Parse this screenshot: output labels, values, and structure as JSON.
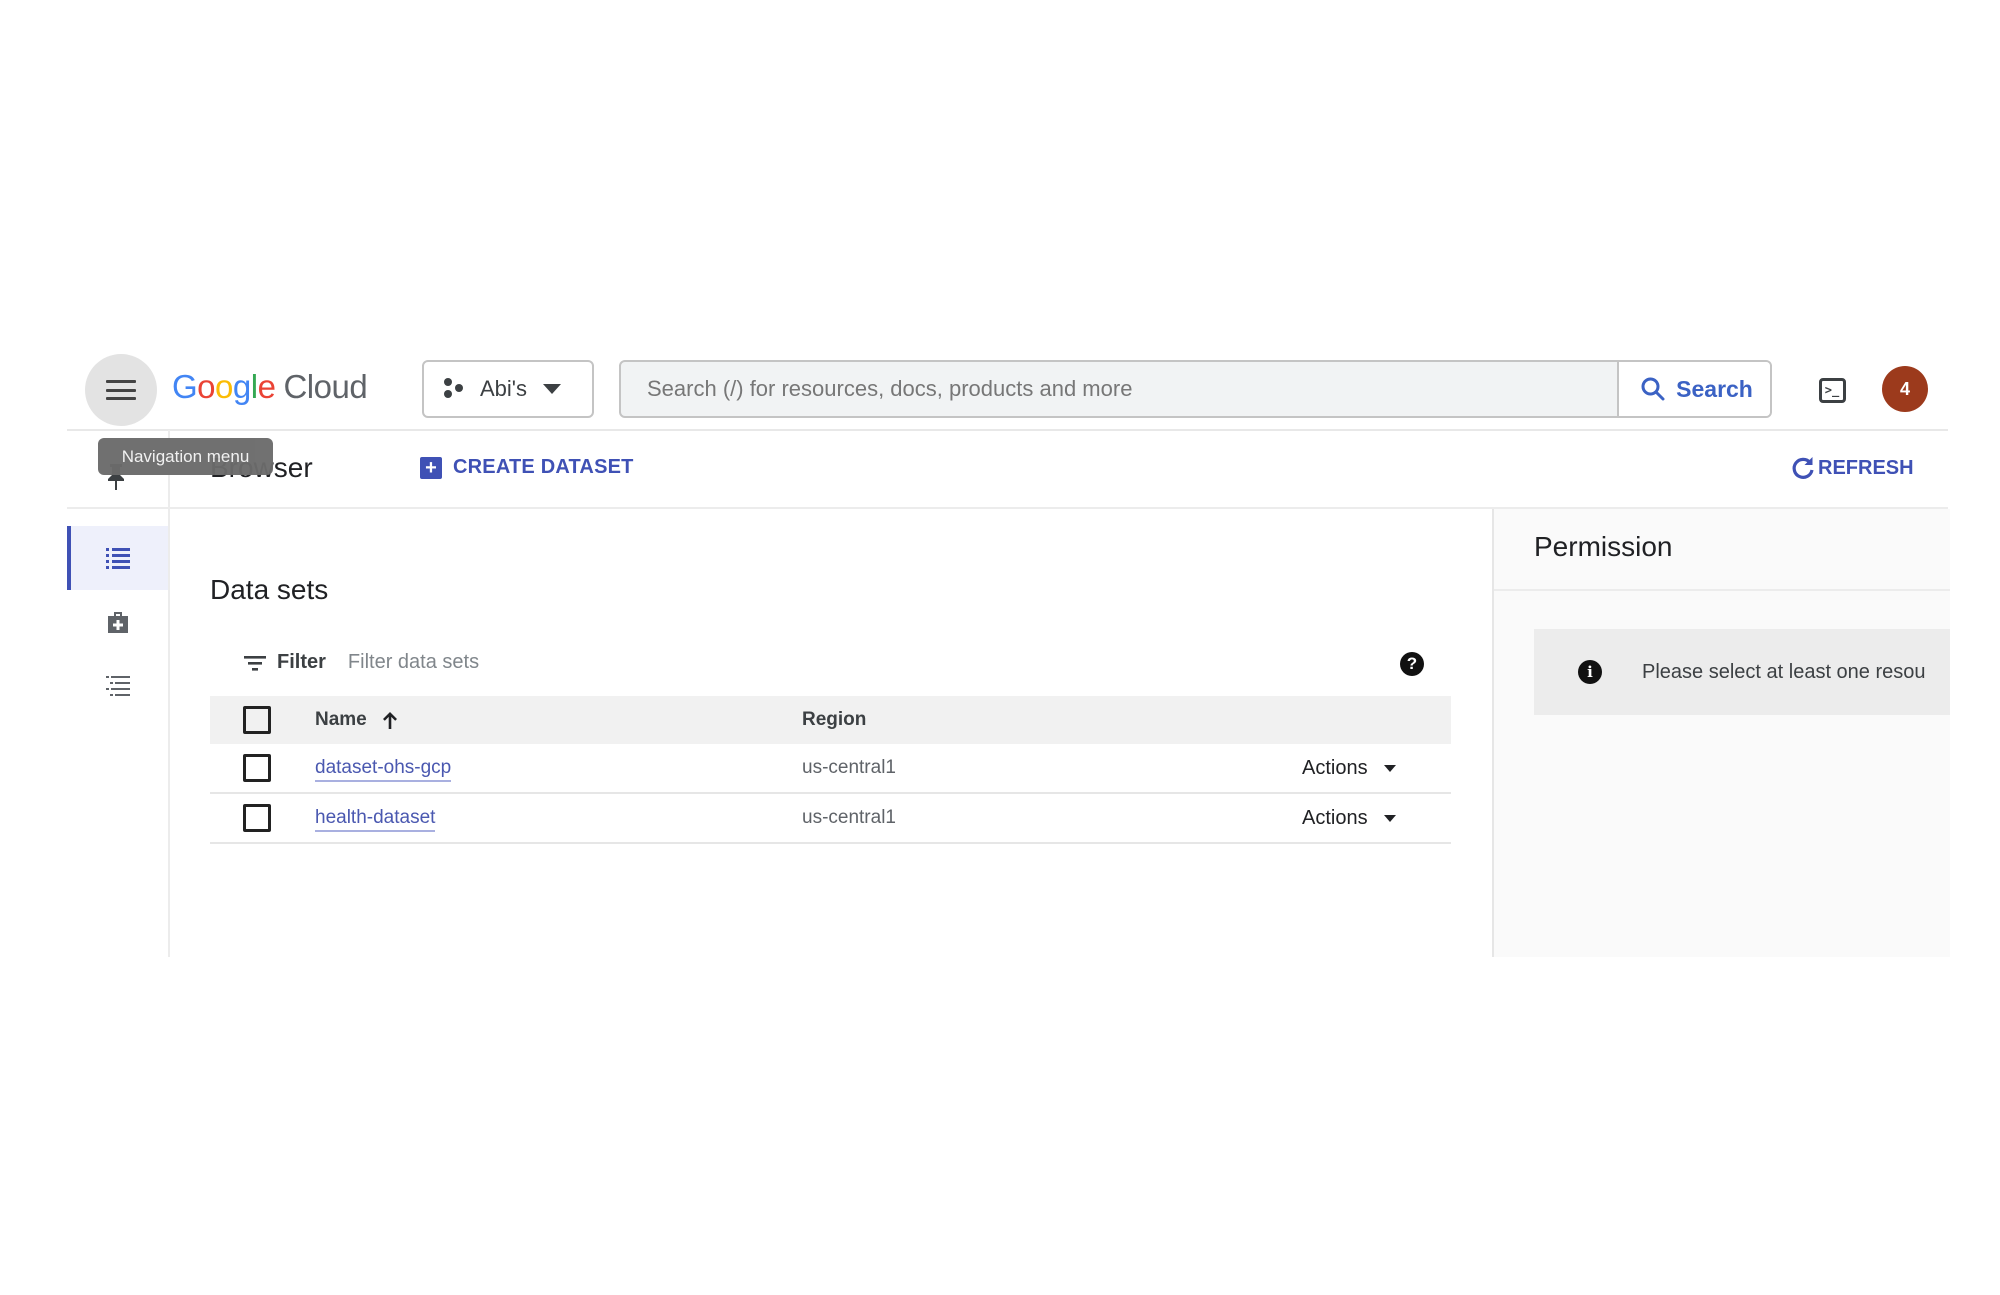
{
  "header": {
    "menu_tooltip": "Navigation menu",
    "logo_google": [
      "G",
      "o",
      "o",
      "g",
      "l",
      "e"
    ],
    "logo_cloud": "Cloud",
    "project": "Abi's",
    "search_placeholder": "Search (/) for resources, docs, products and more",
    "search_button": "Search",
    "terminal_glyph": ">_",
    "avatar_initial": "4",
    "avatar_color": "#9c3a1c"
  },
  "toolbar": {
    "page_title": "Browser",
    "page_title_visible": "wser",
    "create_label": "CREATE DATASET",
    "refresh_label": "REFRESH",
    "accent_color": "#3f51b5"
  },
  "sidebar": {
    "items": [
      {
        "icon": "list-icon",
        "active": true
      },
      {
        "icon": "medical-bag-icon",
        "active": false
      },
      {
        "icon": "indented-list-icon",
        "active": false
      }
    ]
  },
  "main": {
    "title": "Data sets",
    "filter_label": "Filter",
    "filter_placeholder": "Filter data sets",
    "columns": {
      "name": "Name",
      "region": "Region"
    },
    "rows": [
      {
        "name": "dataset-ohs-gcp",
        "region": "us-central1",
        "actions": "Actions"
      },
      {
        "name": "health-dataset",
        "region": "us-central1",
        "actions": "Actions"
      }
    ]
  },
  "permission": {
    "title": "Permission",
    "message": "Please select at least one resou"
  }
}
